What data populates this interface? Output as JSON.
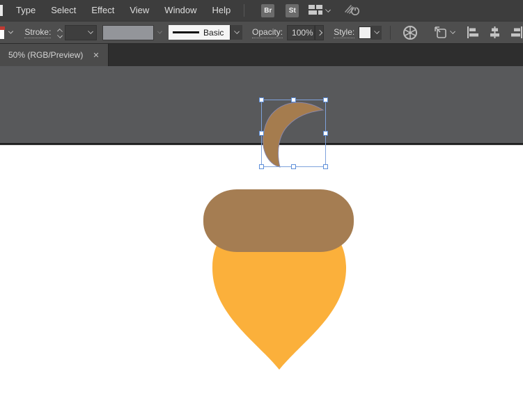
{
  "menubar": {
    "items": [
      "Type",
      "Select",
      "Effect",
      "View",
      "Window",
      "Help"
    ],
    "bridge_button": "Br",
    "stock_button": "St"
  },
  "control_bar": {
    "stroke_label": "Stroke:",
    "brush_name": "Basic",
    "opacity_label": "Opacity:",
    "opacity_value": "100%",
    "style_label": "Style:"
  },
  "document_tab": {
    "title": "50% (RGB/Preview)",
    "close_glyph": "✕"
  },
  "canvas": {
    "pasteboard_color": "#58595B",
    "artboard_color": "#FFFFFF",
    "artboard_edge_color": "#101010",
    "acorn_cap_color": "#A57D52",
    "acorn_body_color": "#FBB03B",
    "crescent_color": "#A57C4E",
    "crescent_outline": "#8A87A8",
    "selection_color": "#7EA2DC",
    "handle_fill": "#FFFFFF",
    "handle_border": "#5C8ED9"
  }
}
